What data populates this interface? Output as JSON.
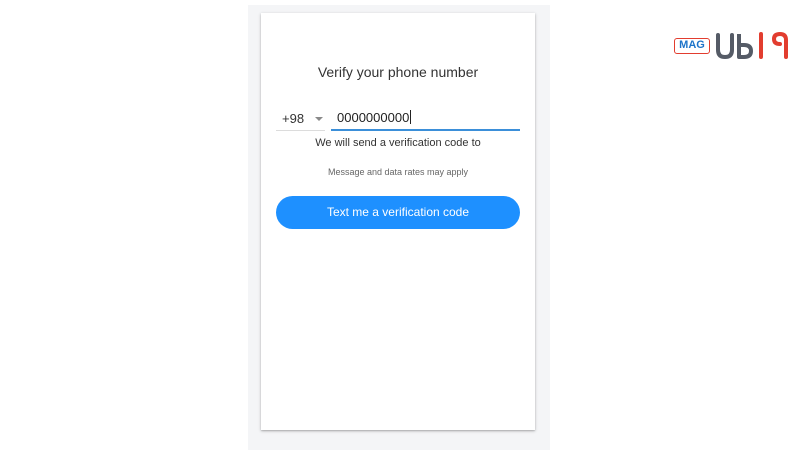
{
  "card": {
    "title": "Verify your phone number",
    "country_code": "+98",
    "phone_value": "0000000000",
    "send_note": "We will send a verification code to",
    "rates_note": "Message and data rates may apply",
    "button_label": "Text me a verification code"
  },
  "watermark": {
    "mag_text": "MAG",
    "brand_text": "UB19"
  },
  "colors": {
    "accent": "#1e90ff",
    "input_underline": "#3b8fd9",
    "logo_red": "#e23d2f",
    "logo_blue": "#1d74c9",
    "logo_dark": "#555b66"
  },
  "icons": [
    "dropdown-caret-icon"
  ]
}
